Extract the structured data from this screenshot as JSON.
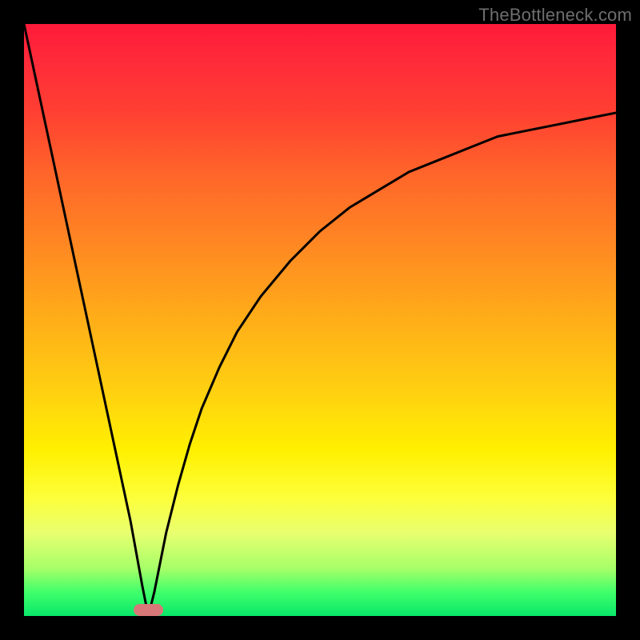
{
  "watermark": "TheBottleneck.com",
  "colors": {
    "frame_bg": "#000000",
    "curve_stroke": "#000000",
    "marker_fill": "#d97878",
    "watermark_color": "#6e6e6e",
    "gradient_stops": [
      "#ff1a3a",
      "#ff2a3a",
      "#ff4032",
      "#ff642a",
      "#ff8a22",
      "#ffae18",
      "#ffd011",
      "#fff000",
      "#fdff3a",
      "#e8ff70",
      "#a6ff68",
      "#3fff6a",
      "#09e86a"
    ]
  },
  "chart_data": {
    "type": "line",
    "title": "",
    "xlabel": "",
    "ylabel": "",
    "xlim": [
      0,
      100
    ],
    "ylim": [
      0,
      100
    ],
    "grid": false,
    "legend": false,
    "note": "x and value are percent of plot width/height; value=0 is bottom (green), value=100 top (red). Curve dips to 0 near x≈21 then rises asymptotically toward ~85.",
    "series": [
      {
        "name": "bottleneck-curve",
        "x": [
          0,
          3,
          6,
          9,
          12,
          15,
          18,
          20,
          21,
          22,
          24,
          26,
          28,
          30,
          33,
          36,
          40,
          45,
          50,
          55,
          60,
          65,
          70,
          75,
          80,
          85,
          90,
          95,
          100
        ],
        "value": [
          100,
          86,
          72,
          58,
          44,
          30,
          16,
          5,
          0,
          4,
          14,
          22,
          29,
          35,
          42,
          48,
          54,
          60,
          65,
          69,
          72,
          75,
          77,
          79,
          81,
          82,
          83,
          84,
          85
        ]
      }
    ],
    "marker": {
      "name": "optimal-point",
      "x_percent": 21,
      "y_percent": 0,
      "width_percent": 5,
      "height_percent": 2
    }
  }
}
